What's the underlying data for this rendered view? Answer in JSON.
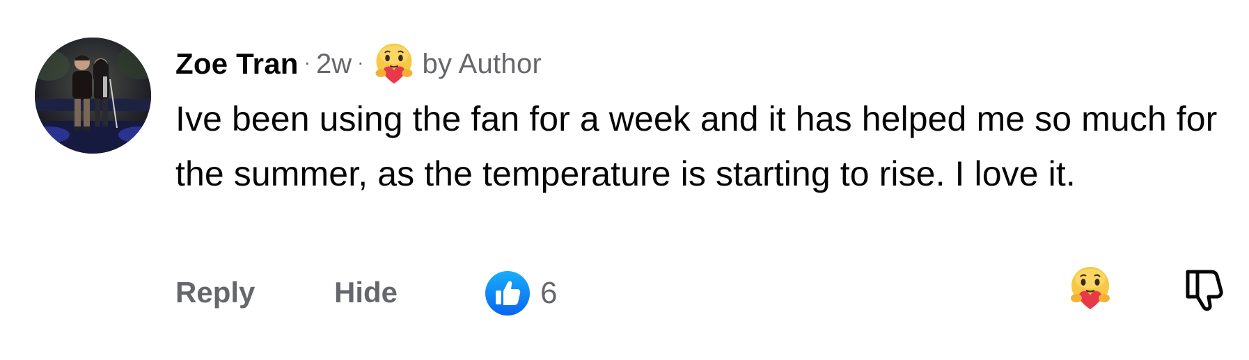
{
  "comment": {
    "author": "Zoe Tran",
    "separator": "·",
    "time": "2w",
    "reaction_icon": "care-emoji-icon",
    "by_author": "by Author",
    "text": "Ive been using the fan for a week and it has helped me so much for the summer, as the temperature is starting to rise. I love it."
  },
  "actions": {
    "reply_label": "Reply",
    "hide_label": "Hide",
    "like_icon": "thumbs-up-icon",
    "like_count": "6",
    "react_icon": "care-emoji-icon",
    "dislike_icon": "thumbs-down-icon"
  },
  "colors": {
    "text_primary": "#050505",
    "text_secondary": "#65676b",
    "like_blue": "#1b74e4",
    "care_yellow": "#f7c843",
    "care_heart": "#e8394b"
  }
}
